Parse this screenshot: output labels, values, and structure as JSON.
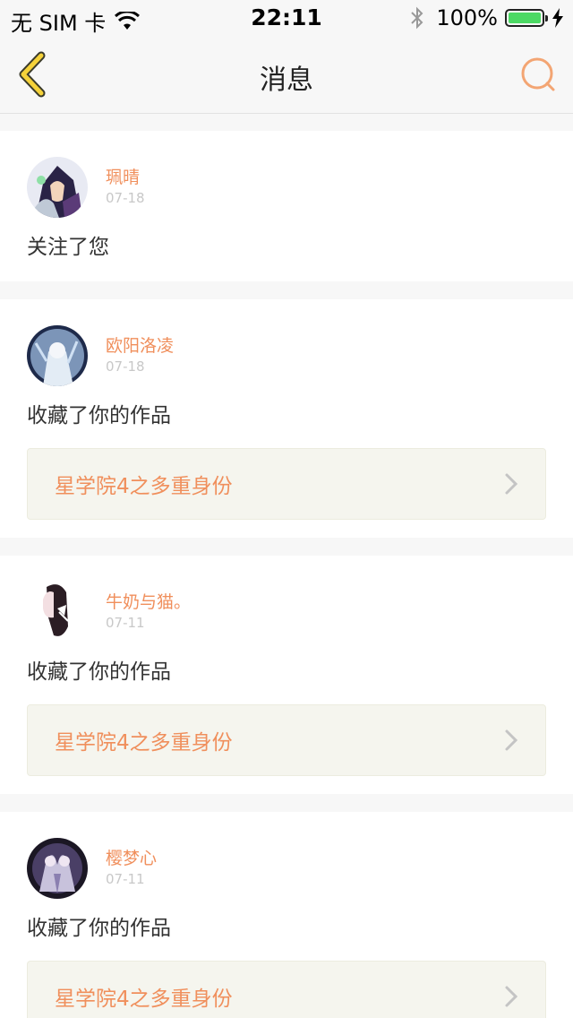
{
  "status_bar": {
    "carrier": "无 SIM 卡",
    "time": "22:11",
    "battery": "100%"
  },
  "nav": {
    "title": "消息",
    "back_icon": "chevron-left-icon",
    "search_icon": "search-icon"
  },
  "colors": {
    "accent": "#f08f5c",
    "back_arrow": "#f5d23a",
    "battery": "#4cd964"
  },
  "messages": [
    {
      "user": "珮晴",
      "time": "07-18",
      "action": "关注了您"
    },
    {
      "user": "欧阳洛凌",
      "time": "07-18",
      "action": "收藏了你的作品",
      "work": "星学院4之多重身份"
    },
    {
      "user": "牛奶与猫。",
      "time": "07-11",
      "action": "收藏了你的作品",
      "work": "星学院4之多重身份"
    },
    {
      "user": "樱梦心",
      "time": "07-11",
      "action": "收藏了你的作品",
      "work": "星学院4之多重身份"
    }
  ]
}
